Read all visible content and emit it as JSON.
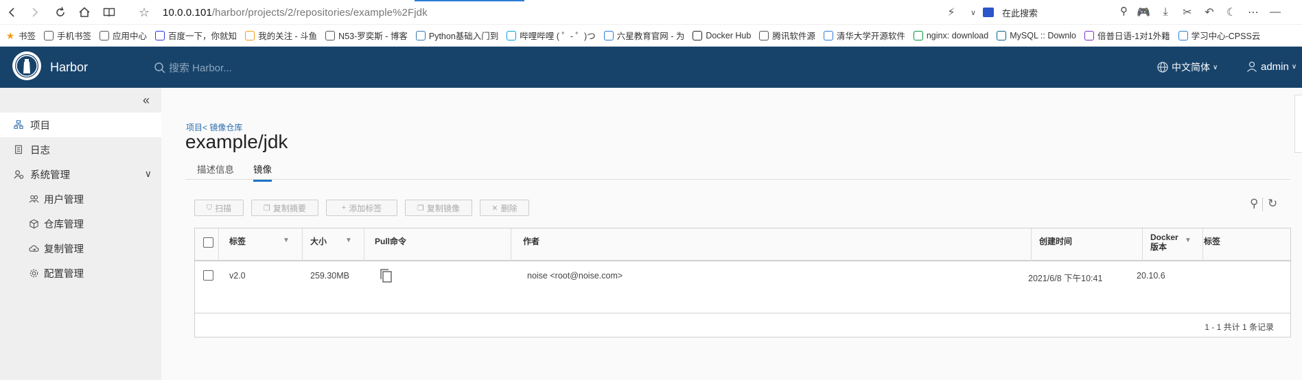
{
  "browser": {
    "url_host": "10.0.0.101",
    "url_path": "/harbor/projects/2/repositories/example%2Fjdk",
    "search_placeholder": "在此搜索",
    "bookmarks": [
      {
        "label": "书签",
        "icon": "star-icon",
        "color": "#f39c12"
      },
      {
        "label": "手机书签",
        "icon": "phone-icon",
        "color": "#555"
      },
      {
        "label": "应用中心",
        "icon": "apps-icon",
        "color": "#555"
      },
      {
        "label": "百度一下，你就知",
        "icon": "baidu-icon",
        "color": "#2932e1"
      },
      {
        "label": "我的关注 - 斗鱼",
        "icon": "douyu-icon",
        "color": "#f39c12"
      },
      {
        "label": "N53-罗奕斯 - 博客",
        "icon": "globe-icon",
        "color": "#555"
      },
      {
        "label": "Python基础入门到",
        "icon": "python-icon",
        "color": "#3776ab"
      },
      {
        "label": "哔哩哔哩 ( ゜- ゜)つ",
        "icon": "bilibili-icon",
        "color": "#00a1d6"
      },
      {
        "label": "六星教育官网 - 为",
        "icon": "six-icon",
        "color": "#2b7cd3"
      },
      {
        "label": "Docker Hub",
        "icon": "docker-icon",
        "color": "#222"
      },
      {
        "label": "腾讯软件源",
        "icon": "globe-icon",
        "color": "#555"
      },
      {
        "label": "清华大学开源软件",
        "icon": "tsinghua-icon",
        "color": "#2b7cd3"
      },
      {
        "label": "nginx: download",
        "icon": "nginx-icon",
        "color": "#009639"
      },
      {
        "label": "MySQL :: Downlo",
        "icon": "mysql-icon",
        "color": "#00618a"
      },
      {
        "label": "倍普日语-1对1外籍",
        "icon": "beipu-icon",
        "color": "#7b2cbf"
      },
      {
        "label": "学习中心-CPSS云",
        "icon": "cpss-icon",
        "color": "#2b7cd3"
      }
    ]
  },
  "harbor": {
    "brand": "Harbor",
    "search_placeholder": "搜索 Harbor...",
    "language": "中文简体",
    "user": "admin"
  },
  "sidebar": {
    "items": [
      {
        "label": "项目",
        "icon": "project-icon"
      },
      {
        "label": "日志",
        "icon": "log-icon"
      },
      {
        "label": "系统管理",
        "icon": "admin-icon"
      },
      {
        "label": "用户管理",
        "icon": "users-icon"
      },
      {
        "label": "仓库管理",
        "icon": "registry-icon"
      },
      {
        "label": "复制管理",
        "icon": "replication-icon"
      },
      {
        "label": "配置管理",
        "icon": "config-icon"
      }
    ]
  },
  "main": {
    "breadcrumb": "项目< 镜像仓库",
    "title": "example/jdk",
    "tabs": [
      "描述信息",
      "镜像"
    ],
    "actions": [
      "扫描",
      "复制摘要",
      "添加标签",
      "复制镜像",
      "删除"
    ],
    "columns": [
      "标签",
      "大小",
      "Pull命令",
      "作者",
      "创建时间",
      "Docker 版本",
      "标签"
    ],
    "docker_version_header_lines": [
      "Docker",
      "版本"
    ],
    "rows": [
      {
        "tag": "v2.0",
        "size": "259.30MB",
        "author": "noise <root@noise.com>",
        "created": "2021/6/8 下午10:41",
        "docker_version": "20.10.6",
        "labels": ""
      }
    ],
    "footer": "1 - 1 共计 1 条记录"
  },
  "colors": {
    "header": "#17436b",
    "accent": "#1f74c7",
    "sidebar": "#efefef"
  }
}
